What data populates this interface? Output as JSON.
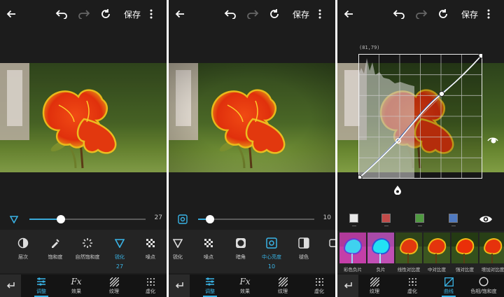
{
  "colors": {
    "accent": "#3ab4e6",
    "panel_bg": "#1c1c1c",
    "toolbar_bg": "#242424",
    "nav_bg": "#141414"
  },
  "topbar": {
    "save_label": "保存",
    "icons": [
      "back-arrow-icon",
      "undo-icon",
      "redo-icon",
      "reset-icon",
      "more-icon"
    ]
  },
  "screen1": {
    "slider": {
      "value": "27",
      "fraction": 0.27
    },
    "tools": [
      {
        "label": "层次",
        "icon": "levels-icon"
      },
      {
        "label": "饱和度",
        "icon": "dropper-icon"
      },
      {
        "label": "自然饱和度",
        "icon": "sparkle-icon"
      },
      {
        "label": "锐化",
        "icon": "sharpen-icon",
        "value": "27",
        "active": true
      },
      {
        "label": "噪点",
        "icon": "noise-icon"
      }
    ],
    "nav": [
      {
        "label": "调整",
        "icon": "sliders-icon",
        "active": true
      },
      {
        "label": "效果",
        "icon": "fx-icon"
      },
      {
        "label": "纹理",
        "icon": "texture-icon"
      },
      {
        "label": "虚化",
        "icon": "blur-icon"
      }
    ]
  },
  "screen2": {
    "slider": {
      "value": "10",
      "fraction": 0.1
    },
    "tools": [
      {
        "label": "锐化",
        "icon": "sharpen-icon"
      },
      {
        "label": "噪点",
        "icon": "noise-icon"
      },
      {
        "label": "暗角",
        "icon": "vignette-icon"
      },
      {
        "label": "中心亮度",
        "icon": "center-brightness-icon",
        "value": "10",
        "active": true
      },
      {
        "label": "褪色",
        "icon": "fade-icon"
      }
    ],
    "nav": [
      {
        "label": "调整",
        "icon": "sliders-icon",
        "active": true
      },
      {
        "label": "效果",
        "icon": "fx-icon"
      },
      {
        "label": "纹理",
        "icon": "texture-icon"
      },
      {
        "label": "虚化",
        "icon": "blur-icon"
      }
    ]
  },
  "screen3": {
    "curve_coords": "(81,79)",
    "channels": [
      {
        "name": "rgb",
        "color": "#e8e8e8"
      },
      {
        "name": "red",
        "color": "#c24a48"
      },
      {
        "name": "green",
        "color": "#4f9a40"
      },
      {
        "name": "blue",
        "color": "#4f79c0"
      }
    ],
    "presets": [
      {
        "label": "彩色负片"
      },
      {
        "label": "负片"
      },
      {
        "label": "线性对比度"
      },
      {
        "label": "中对比度"
      },
      {
        "label": "强对比度"
      },
      {
        "label": "增加对比度"
      }
    ],
    "nav": [
      {
        "label": "纹理",
        "icon": "texture-icon"
      },
      {
        "label": "虚化",
        "icon": "blur-icon"
      },
      {
        "label": "曲线",
        "icon": "curve-icon",
        "active": true
      },
      {
        "label": "色相/饱和度",
        "icon": "hue-saturation-icon"
      }
    ]
  }
}
